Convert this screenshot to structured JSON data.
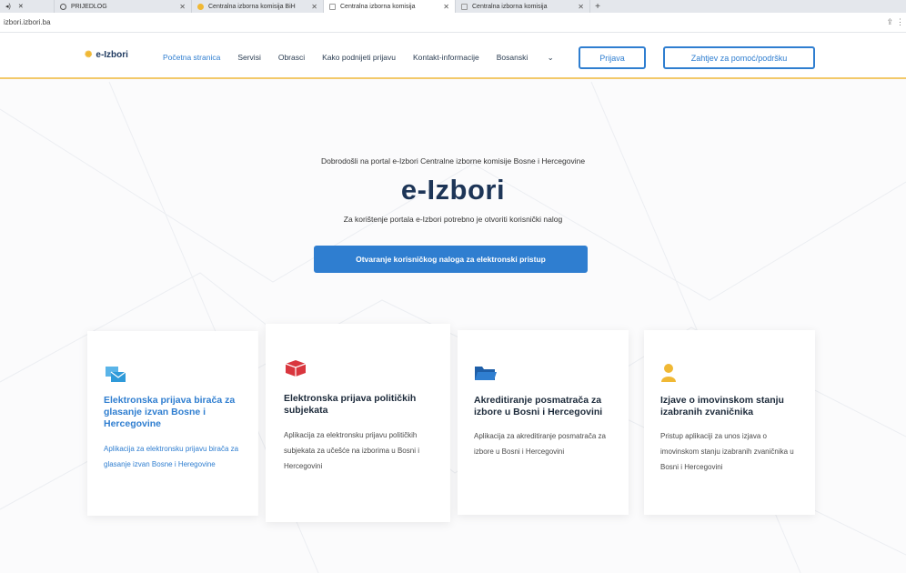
{
  "browser": {
    "tabs": [
      {
        "label": "PRIJEDLOG",
        "close": "✕"
      },
      {
        "label": "Centralna izborna komisija BiH",
        "close": "✕"
      },
      {
        "label": "Centralna izborna komisija",
        "close": "✕"
      },
      {
        "label": "Centralna izborna komisija",
        "close": "✕"
      }
    ],
    "new_tab": "+",
    "url": "izbori.izbori.ba"
  },
  "header": {
    "logo": "e-Izbori",
    "nav": [
      "Početna stranica",
      "Servisi",
      "Obrasci",
      "Kako podnijeti prijavu",
      "Kontakt-informacije",
      "Bosanski"
    ],
    "login_label": "Prijava",
    "help_label": "Zahtjev za pomoć/podršku"
  },
  "hero": {
    "welcome": "Dobrodošli na portal e-Izbori Centralne izborne komisije Bosne i Hercegovine",
    "title": "e-Izbori",
    "subtitle": "Za korištenje portala e-Izbori potrebno je otvoriti korisnički nalog",
    "cta_label": "Otvaranje korisničkog naloga za elektronski pristup"
  },
  "cards": [
    {
      "title": "Elektronska prijava birača za glasanje izvan Bosne i Hercegovine",
      "text": "Aplikacija za elektronsku prijavu birača za glasanje izvan Bosne i Heregovine",
      "icon": "ballot-envelope-icon"
    },
    {
      "title": "Elektronska prijava političkih subjekata",
      "text": "Aplikacija za elektronsku prijavu političkih subjekata za učešće na izborima u Bosni i Hercegovini",
      "icon": "open-box-icon"
    },
    {
      "title": "Akreditiranje posmatrača za izbore u Bosni i Hercegovini",
      "text": "Aplikacija za akreditiranje posmatrača za izbore u Bosni i Hercegovini",
      "icon": "folder-icon"
    },
    {
      "title": "Izjave o imovinskom stanju izabranih zvaničnika",
      "text": "Pristup aplikaciji za unos izjava o imovinskom stanju izabranih zvaničnika u Bosni i Hercegovini",
      "icon": "person-icon"
    }
  ],
  "colors": {
    "accent": "#2f7ed0",
    "dark": "#1d3557",
    "gold": "#f0b834",
    "red": "#d9363e"
  }
}
